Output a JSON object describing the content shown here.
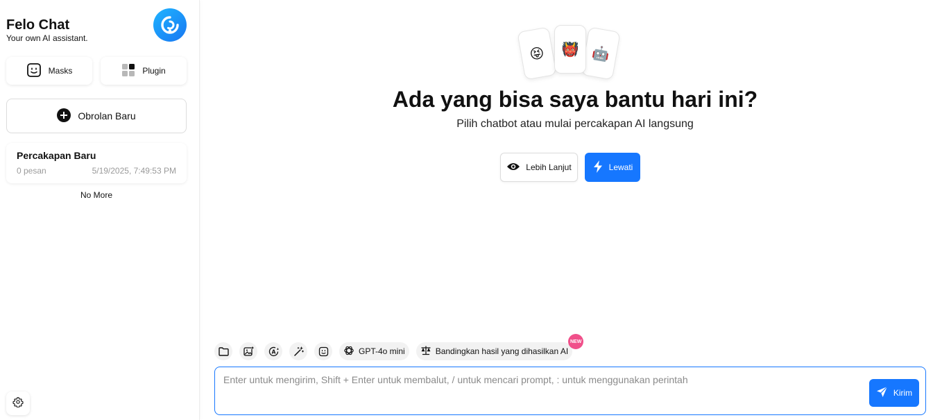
{
  "sidebar": {
    "brand": {
      "title": "Felo Chat",
      "subtitle": "Your own AI assistant.",
      "logo_icon": "felo-logo-icon"
    },
    "masks_label": "Masks",
    "plugin_label": "Plugin",
    "new_chat_label": "Obrolan Baru",
    "chats": [
      {
        "title": "Percakapan Baru",
        "count": "0 pesan",
        "date": "5/19/2025, 7:49:53 PM"
      }
    ],
    "no_more": "No More",
    "settings_icon": "gear-icon"
  },
  "main": {
    "cards": [
      "😝",
      "👹",
      "🤖"
    ],
    "headline": "Ada yang bisa saya bantu hari ini?",
    "subline": "Pilih chatbot atau mulai percakapan AI langsung",
    "more_label": "Lebih Lanjut",
    "skip_label": "Lewati"
  },
  "composer": {
    "tools": [
      "folder-icon",
      "image-plus-icon",
      "translate-icon",
      "magic-wand-icon",
      "mask-face-icon"
    ],
    "model_label": "GPT-4o mini",
    "compare_label": "Bandingkan hasil yang dihasilkan AI",
    "new_badge": "NEW",
    "placeholder": "Enter untuk mengirim, Shift + Enter untuk membalut, / untuk mencari prompt, : untuk menggunakan perintah",
    "value": "",
    "send_label": "Kirim"
  },
  "colors": {
    "accent": "#1677ff",
    "badge": "#f0508a",
    "logo_gradient_start": "#1fb4ff",
    "logo_gradient_end": "#1877f2"
  }
}
